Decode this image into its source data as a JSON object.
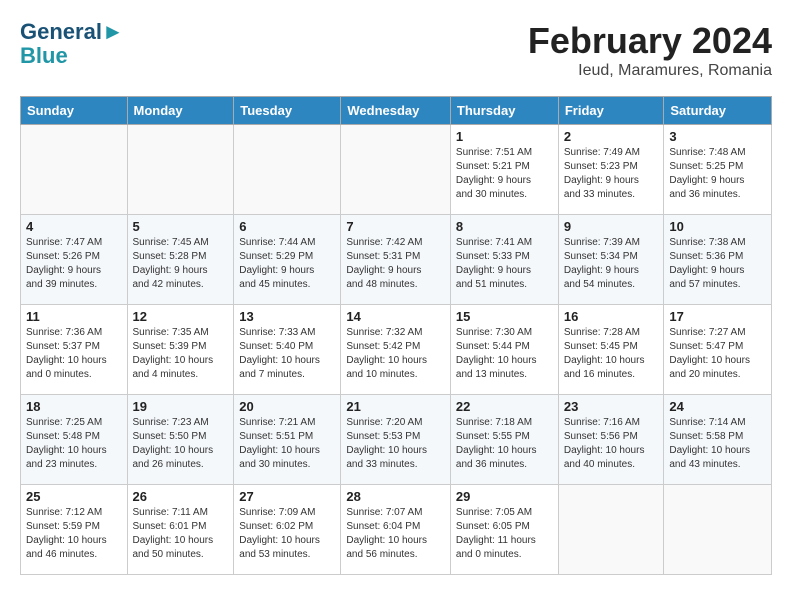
{
  "header": {
    "logo_line1": "General",
    "logo_line2": "Blue",
    "month": "February 2024",
    "location": "Ieud, Maramures, Romania"
  },
  "weekdays": [
    "Sunday",
    "Monday",
    "Tuesday",
    "Wednesday",
    "Thursday",
    "Friday",
    "Saturday"
  ],
  "weeks": [
    [
      {
        "day": "",
        "info": ""
      },
      {
        "day": "",
        "info": ""
      },
      {
        "day": "",
        "info": ""
      },
      {
        "day": "",
        "info": ""
      },
      {
        "day": "1",
        "info": "Sunrise: 7:51 AM\nSunset: 5:21 PM\nDaylight: 9 hours\nand 30 minutes."
      },
      {
        "day": "2",
        "info": "Sunrise: 7:49 AM\nSunset: 5:23 PM\nDaylight: 9 hours\nand 33 minutes."
      },
      {
        "day": "3",
        "info": "Sunrise: 7:48 AM\nSunset: 5:25 PM\nDaylight: 9 hours\nand 36 minutes."
      }
    ],
    [
      {
        "day": "4",
        "info": "Sunrise: 7:47 AM\nSunset: 5:26 PM\nDaylight: 9 hours\nand 39 minutes."
      },
      {
        "day": "5",
        "info": "Sunrise: 7:45 AM\nSunset: 5:28 PM\nDaylight: 9 hours\nand 42 minutes."
      },
      {
        "day": "6",
        "info": "Sunrise: 7:44 AM\nSunset: 5:29 PM\nDaylight: 9 hours\nand 45 minutes."
      },
      {
        "day": "7",
        "info": "Sunrise: 7:42 AM\nSunset: 5:31 PM\nDaylight: 9 hours\nand 48 minutes."
      },
      {
        "day": "8",
        "info": "Sunrise: 7:41 AM\nSunset: 5:33 PM\nDaylight: 9 hours\nand 51 minutes."
      },
      {
        "day": "9",
        "info": "Sunrise: 7:39 AM\nSunset: 5:34 PM\nDaylight: 9 hours\nand 54 minutes."
      },
      {
        "day": "10",
        "info": "Sunrise: 7:38 AM\nSunset: 5:36 PM\nDaylight: 9 hours\nand 57 minutes."
      }
    ],
    [
      {
        "day": "11",
        "info": "Sunrise: 7:36 AM\nSunset: 5:37 PM\nDaylight: 10 hours\nand 0 minutes."
      },
      {
        "day": "12",
        "info": "Sunrise: 7:35 AM\nSunset: 5:39 PM\nDaylight: 10 hours\nand 4 minutes."
      },
      {
        "day": "13",
        "info": "Sunrise: 7:33 AM\nSunset: 5:40 PM\nDaylight: 10 hours\nand 7 minutes."
      },
      {
        "day": "14",
        "info": "Sunrise: 7:32 AM\nSunset: 5:42 PM\nDaylight: 10 hours\nand 10 minutes."
      },
      {
        "day": "15",
        "info": "Sunrise: 7:30 AM\nSunset: 5:44 PM\nDaylight: 10 hours\nand 13 minutes."
      },
      {
        "day": "16",
        "info": "Sunrise: 7:28 AM\nSunset: 5:45 PM\nDaylight: 10 hours\nand 16 minutes."
      },
      {
        "day": "17",
        "info": "Sunrise: 7:27 AM\nSunset: 5:47 PM\nDaylight: 10 hours\nand 20 minutes."
      }
    ],
    [
      {
        "day": "18",
        "info": "Sunrise: 7:25 AM\nSunset: 5:48 PM\nDaylight: 10 hours\nand 23 minutes."
      },
      {
        "day": "19",
        "info": "Sunrise: 7:23 AM\nSunset: 5:50 PM\nDaylight: 10 hours\nand 26 minutes."
      },
      {
        "day": "20",
        "info": "Sunrise: 7:21 AM\nSunset: 5:51 PM\nDaylight: 10 hours\nand 30 minutes."
      },
      {
        "day": "21",
        "info": "Sunrise: 7:20 AM\nSunset: 5:53 PM\nDaylight: 10 hours\nand 33 minutes."
      },
      {
        "day": "22",
        "info": "Sunrise: 7:18 AM\nSunset: 5:55 PM\nDaylight: 10 hours\nand 36 minutes."
      },
      {
        "day": "23",
        "info": "Sunrise: 7:16 AM\nSunset: 5:56 PM\nDaylight: 10 hours\nand 40 minutes."
      },
      {
        "day": "24",
        "info": "Sunrise: 7:14 AM\nSunset: 5:58 PM\nDaylight: 10 hours\nand 43 minutes."
      }
    ],
    [
      {
        "day": "25",
        "info": "Sunrise: 7:12 AM\nSunset: 5:59 PM\nDaylight: 10 hours\nand 46 minutes."
      },
      {
        "day": "26",
        "info": "Sunrise: 7:11 AM\nSunset: 6:01 PM\nDaylight: 10 hours\nand 50 minutes."
      },
      {
        "day": "27",
        "info": "Sunrise: 7:09 AM\nSunset: 6:02 PM\nDaylight: 10 hours\nand 53 minutes."
      },
      {
        "day": "28",
        "info": "Sunrise: 7:07 AM\nSunset: 6:04 PM\nDaylight: 10 hours\nand 56 minutes."
      },
      {
        "day": "29",
        "info": "Sunrise: 7:05 AM\nSunset: 6:05 PM\nDaylight: 11 hours\nand 0 minutes."
      },
      {
        "day": "",
        "info": ""
      },
      {
        "day": "",
        "info": ""
      }
    ]
  ]
}
